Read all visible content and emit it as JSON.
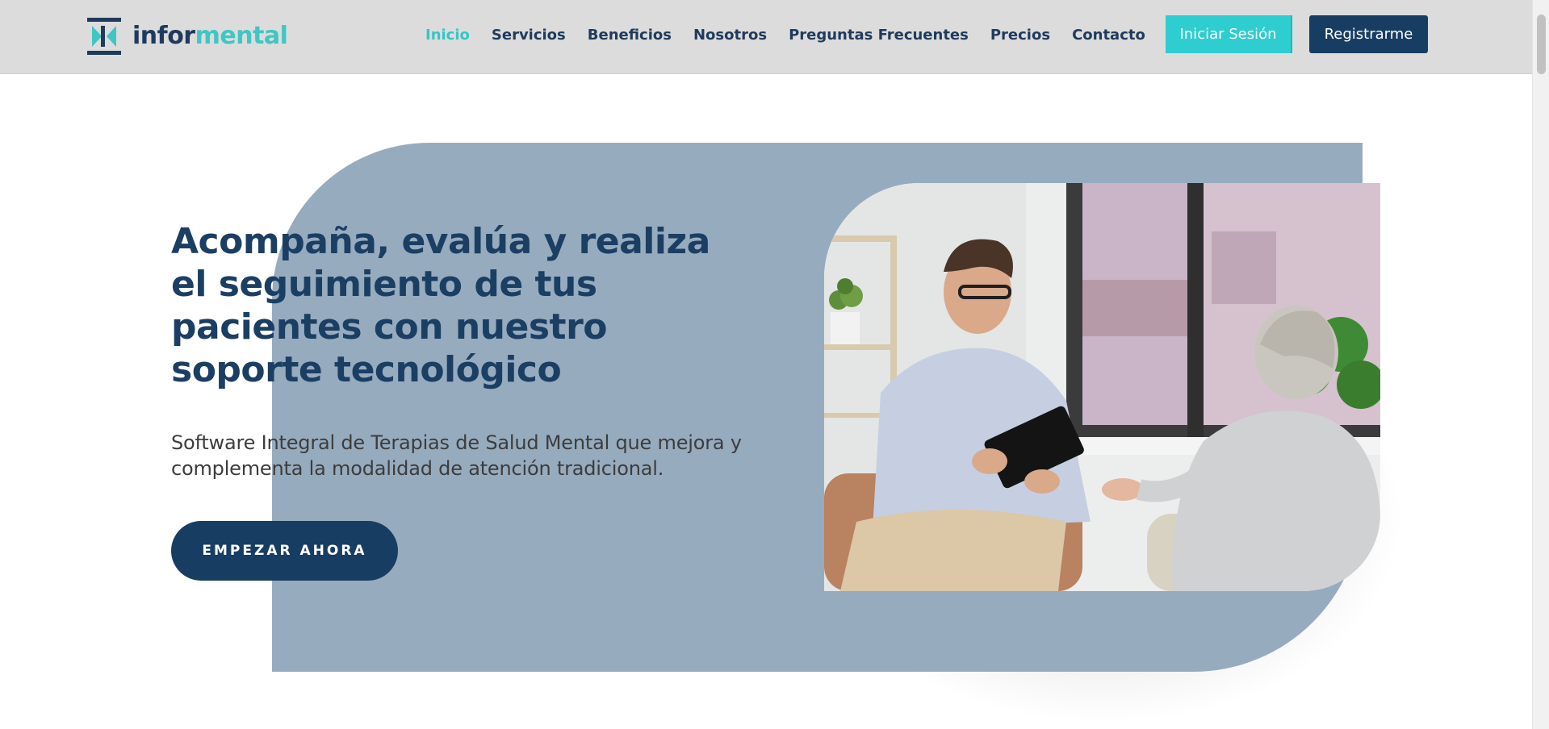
{
  "brand": {
    "name_part1": "infor",
    "name_part2": "mental",
    "colors": {
      "navy": "#173d63",
      "teal": "#36c6c4",
      "hero_bg": "#97abbf"
    }
  },
  "nav": {
    "items": [
      {
        "label": "Inicio",
        "active": true
      },
      {
        "label": "Servicios",
        "active": false
      },
      {
        "label": "Beneficios",
        "active": false
      },
      {
        "label": "Nosotros",
        "active": false
      },
      {
        "label": "Preguntas Frecuentes",
        "active": false
      },
      {
        "label": "Precios",
        "active": false
      },
      {
        "label": "Contacto",
        "active": false
      }
    ],
    "login_label": "Iniciar Sesión",
    "register_label": "Registrarme"
  },
  "hero": {
    "title": "Acompaña, evalúa y realiza el seguimiento de tus pacientes con nuestro soporte tecnológico",
    "subtitle": "Software Integral de Terapias de Salud Mental que mejora y complementa la modalidad de atención tradicional.",
    "cta_label": "EMPEZAR AHORA"
  },
  "icons": {
    "logo": "logo-icon",
    "hero_image": "therapy-session-photo"
  }
}
